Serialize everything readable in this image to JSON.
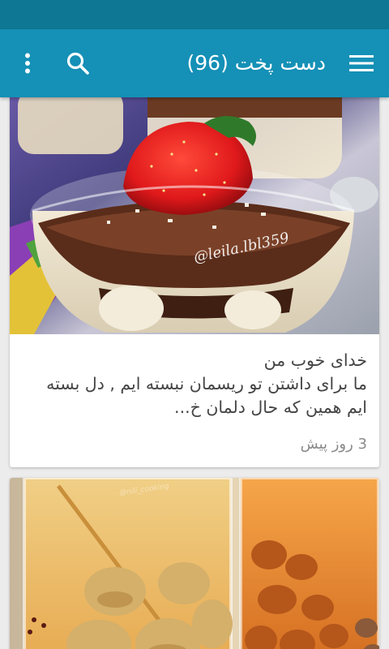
{
  "app_bar": {
    "title": "دست پخت (96)",
    "icons": {
      "menu": "hamburger-menu-icon",
      "search": "search-icon",
      "overflow": "more-vert-icon"
    }
  },
  "feed": {
    "posts": [
      {
        "image_watermark": "@leila.lbl359",
        "text_lines": [
          "خدای خوب من",
          "ما برای داشتن تو ریسمان نبسته ایم , دل بسته",
          "ایم همین که حال دلمان خ..."
        ],
        "time": "3 روز پیش"
      },
      {
        "image_watermark": "@nili_cooking"
      }
    ]
  },
  "colors": {
    "status_bar": "#0e7894",
    "app_bar": "#1590b6",
    "background": "#ececec",
    "card": "#ffffff"
  }
}
